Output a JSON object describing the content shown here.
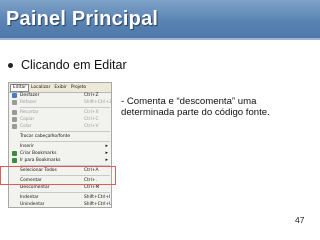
{
  "slide": {
    "title": "Painel Principal",
    "bullet": "Clicando em Editar",
    "description_line1": "- Comenta e “descomenta” uma",
    "description_line2": "determinada parte do código fonte.",
    "page_number": "47"
  },
  "menu": {
    "menubar": [
      "Editar",
      "Localizar",
      "Exibir",
      "Projeto"
    ],
    "items": [
      {
        "label": "Desfazer",
        "shortcut": "Ctrl+Z",
        "disabled": false,
        "icon_color": "#4a7cc0"
      },
      {
        "label": "Refazer",
        "shortcut": "Shift+Ctrl+Z",
        "disabled": true,
        "icon_color": "#9a9a9a"
      },
      {
        "label": "Recortar",
        "shortcut": "Ctrl+X",
        "disabled": true,
        "icon_color": "#9a9a9a"
      },
      {
        "label": "Copiar",
        "shortcut": "Ctrl+C",
        "disabled": true,
        "icon_color": "#9a9a9a"
      },
      {
        "label": "Colar",
        "shortcut": "Ctrl+V",
        "disabled": true,
        "icon_color": "#9a9a9a"
      },
      {
        "label": "Trocar cabeçalho/fonte",
        "shortcut": "",
        "disabled": false,
        "icon_color": ""
      },
      {
        "label": "Inserir",
        "shortcut": "",
        "disabled": false,
        "icon_color": "",
        "submenu": true
      },
      {
        "label": "Criar Bookmarks",
        "shortcut": "",
        "disabled": false,
        "icon_color": "#3c8a3c",
        "submenu": true
      },
      {
        "label": "Ir para Bookmarks",
        "shortcut": "",
        "disabled": false,
        "icon_color": "#3c8a3c",
        "submenu": true
      },
      {
        "label": "Selecionar Todos",
        "shortcut": "Ctrl+A",
        "disabled": false,
        "icon_color": ""
      },
      {
        "label": "Comentar",
        "shortcut": "Ctrl+.",
        "disabled": false,
        "icon_color": ""
      },
      {
        "label": "Descomentar",
        "shortcut": "Ctrl+M",
        "disabled": false,
        "icon_color": ""
      },
      {
        "label": "Indentar",
        "shortcut": "Shift+Ctrl+I",
        "disabled": false,
        "icon_color": ""
      },
      {
        "label": "Unindentar",
        "shortcut": "Shift+Ctrl+U",
        "disabled": false,
        "icon_color": ""
      }
    ]
  },
  "colors": {
    "title_bar": "#5a84b3",
    "highlight": "#e05a5a"
  }
}
